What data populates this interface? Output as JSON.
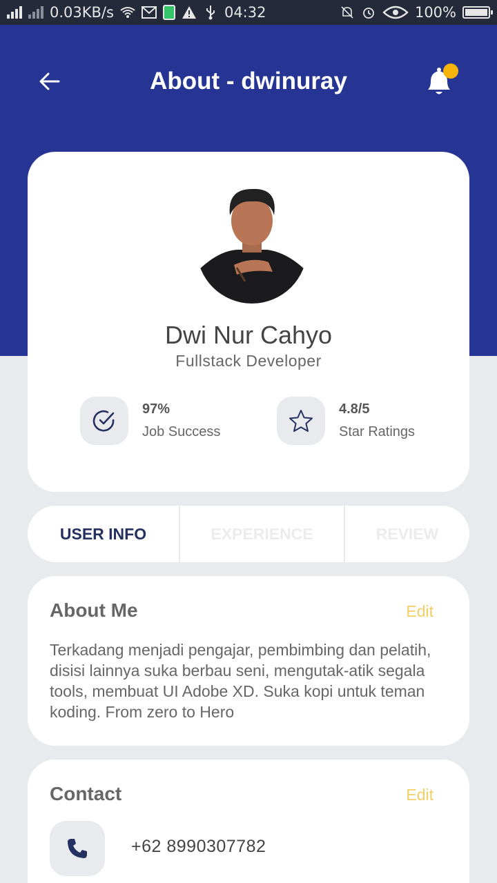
{
  "status_bar": {
    "net_speed": "0.03KB/s",
    "time": "04:32",
    "battery": "100%"
  },
  "header": {
    "title": "About - dwinuray"
  },
  "profile": {
    "name": "Dwi Nur Cahyo",
    "role": "Fullstack  Developer",
    "stats": [
      {
        "value": "97%",
        "label": "Job Success",
        "icon": "check-circle-icon"
      },
      {
        "value": "4.8/5",
        "label": "Star Ratings",
        "icon": "star-icon"
      }
    ]
  },
  "tabs": [
    {
      "label": "USER INFO",
      "active": true
    },
    {
      "label": "EXPERIENCE",
      "active": false
    },
    {
      "label": "REVIEW",
      "active": false
    }
  ],
  "about": {
    "title": "About Me",
    "edit_label": "Edit",
    "text": "Terkadang menjadi pengajar, pembimbing dan pelatih, disisi lainnya suka berbau seni, mengutak-atik segala tools, membuat UI Adobe XD. Suka kopi untuk teman koding. From zero to Hero"
  },
  "contact": {
    "title": "Contact",
    "edit_label": "Edit",
    "phone": "+62 8990307782"
  },
  "colors": {
    "header_blue": "#263594",
    "notification_dot": "#f5b40b",
    "edit_yellow": "#f3cf63",
    "active_tab": "#243060",
    "page_bg": "#e8eaee"
  }
}
